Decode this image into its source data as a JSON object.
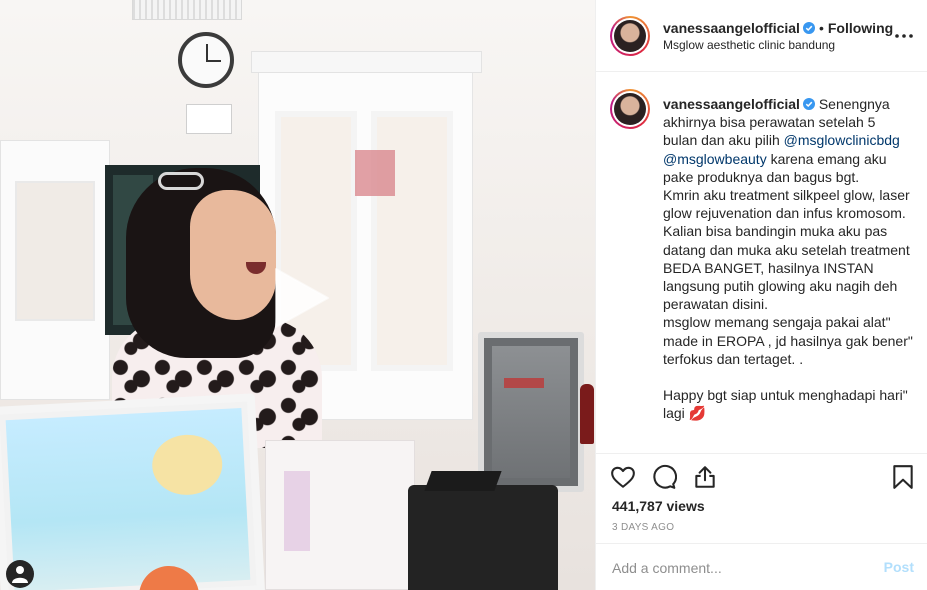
{
  "post": {
    "username": "vanessaangelofficial",
    "verified": true,
    "follow_status": "Following",
    "separator": "•",
    "location": "Msglow aesthetic clinic bandung"
  },
  "caption": {
    "username": "vanessaangelofficial",
    "intro": "Senengnya akhirnya bisa perawatan setelah 5 bulan dan aku pilih",
    "mention1": "@msglowclinicbdg",
    "mention2": "@msglowbeauty",
    "after_mentions": "karena emang aku pake produknya dan bagus bgt.",
    "line2": "Kmrin aku treatment silkpeel glow, laser glow rejuvenation dan infus kromosom.",
    "line3": "Kalian bisa bandingin muka aku pas datang dan muka aku setelah treatment BEDA BANGET, hasilnya INSTAN langsung putih glowing aku nagih deh perawatan disini.",
    "line4": "msglow memang sengaja pakai alat\" made in EROPA , jd hasilnya gak bener\" terfokus dan tertaget. .",
    "line5": "Happy bgt siap untuk menghadapi hari\" lagi",
    "emoji": "💋"
  },
  "stats": {
    "views": "441,787 views",
    "timestamp": "3 DAYS AGO"
  },
  "comment": {
    "placeholder": "Add a comment...",
    "post_label": "Post"
  },
  "icons": {
    "more": "more-options-icon",
    "like": "heart-icon",
    "comment": "comment-icon",
    "share": "share-icon",
    "save": "bookmark-icon",
    "play": "play-icon",
    "tag": "user-tag-icon"
  },
  "colors": {
    "verified": "#3897f0",
    "mention": "#00376b",
    "muted": "#8e8e8e",
    "post_disabled": "#b2dffc"
  }
}
